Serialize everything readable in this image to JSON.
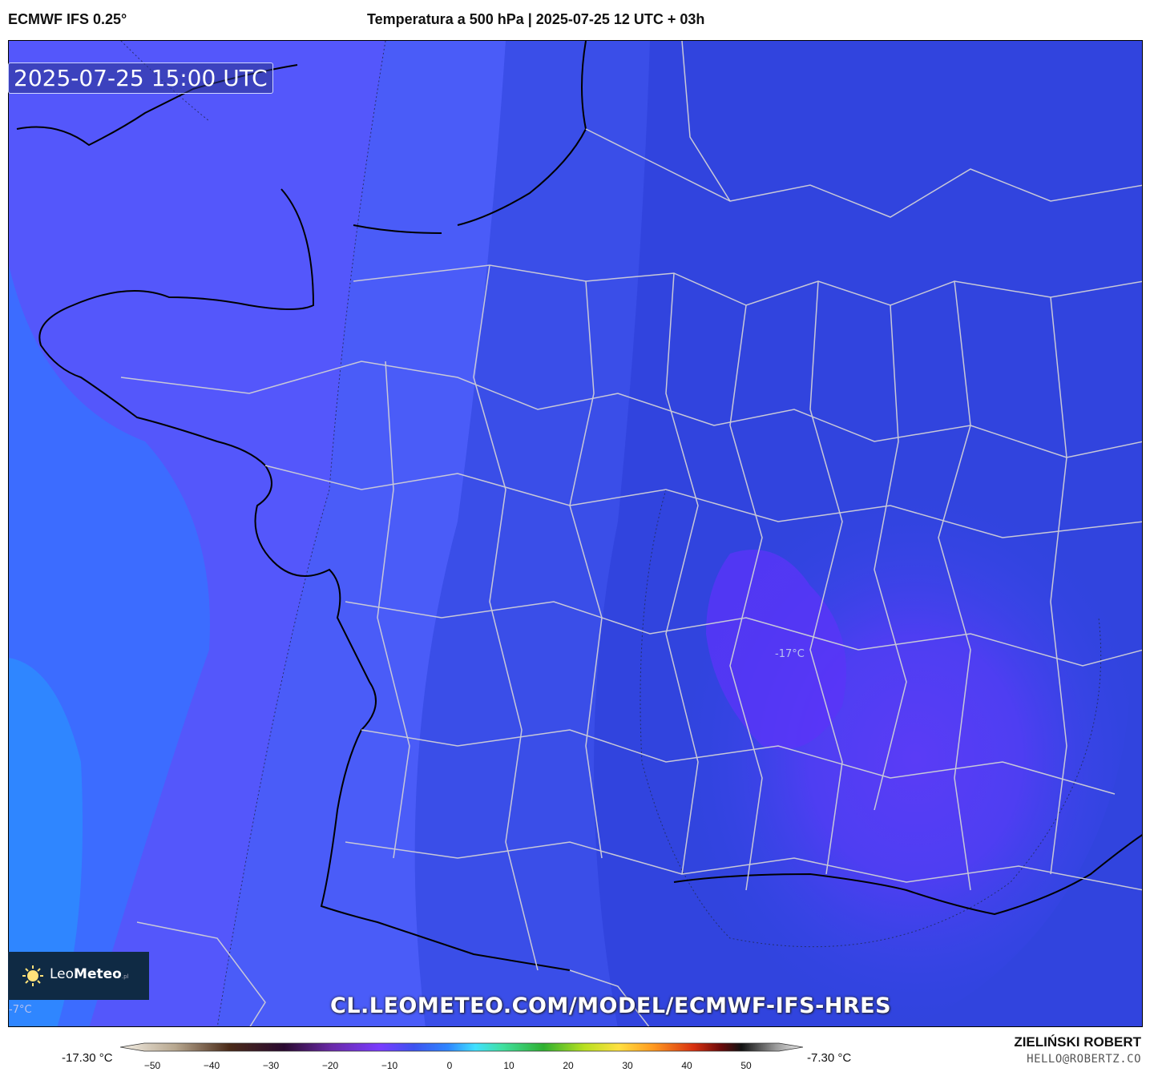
{
  "header": {
    "model": "ECMWF IFS 0.25°",
    "title": "Temperatura a 500 hPa | 2025-07-25 12 UTC + 03h"
  },
  "map": {
    "valid_time": "2025-07-25 15:00 UTC",
    "contour_labels": [
      "-17°C",
      "-7°C"
    ],
    "watermark_url": "CL.LEOMETEO.COM/MODEL/ECMWF-IFS-HRES",
    "logo": {
      "name_light": "Leo",
      "name_bold": "Meteo",
      "suffix": ".pl"
    },
    "colors": {
      "ocean_west": "#2f86ff",
      "atlantic": "#4a6cff",
      "mainland": "#3d53f0",
      "cold_core": "#5a3cf6",
      "east": "#2a40dc"
    }
  },
  "colorbar": {
    "min_label": "-17.30 °C",
    "max_label": "-7.30 °C",
    "ticks": [
      "−50",
      "−40",
      "−30",
      "−20",
      "−10",
      "0",
      "10",
      "20",
      "30",
      "40",
      "50"
    ]
  },
  "credit": {
    "author": "ZIELIŃSKI ROBERT",
    "email": "HELLO@ROBERTZ.CO"
  }
}
